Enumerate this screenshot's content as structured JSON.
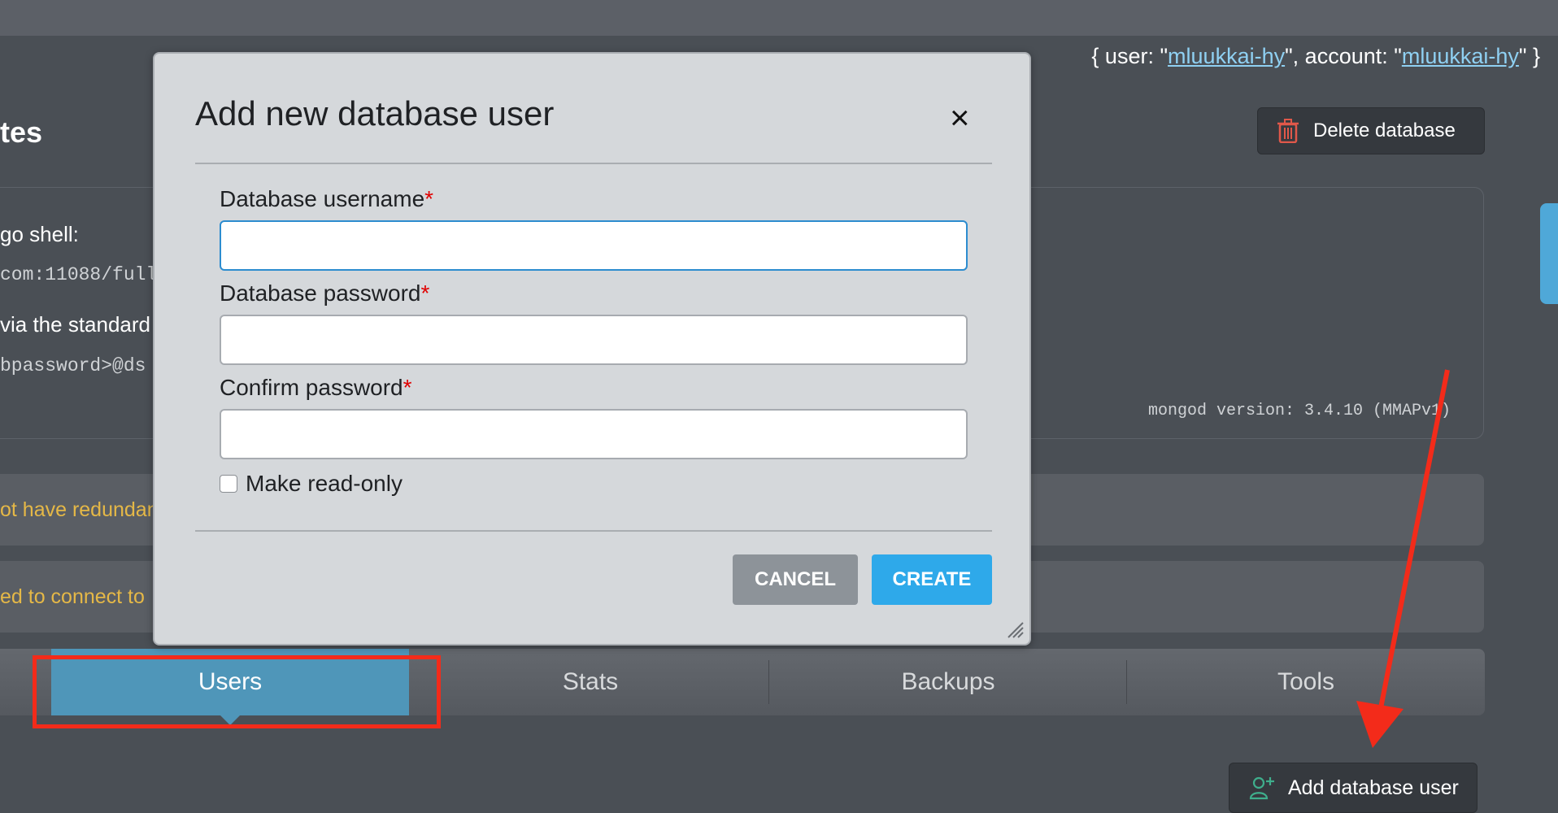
{
  "header": {
    "user_prefix": "{ user: \"",
    "user_name": "mluukkai-hy",
    "account_prefix": "\", account: \"",
    "account_name": "mluukkai-hy",
    "suffix": "\" }"
  },
  "page": {
    "title_partial": "tes",
    "delete_button": "Delete database",
    "shell_label": "go shell:",
    "shell_cmd": "com:11088/full",
    "std_label": "via the standard",
    "std_uri": "bpassword>@ds",
    "version": "mongod version: 3.4.10 (MMAPv1)",
    "alert1": "ot have redundan",
    "alert2": "ed to connect to"
  },
  "tabs": [
    {
      "label": "Users",
      "active": true
    },
    {
      "label": "Stats",
      "active": false
    },
    {
      "label": "Backups",
      "active": false
    },
    {
      "label": "Tools",
      "active": false
    }
  ],
  "add_user_button": "Add database user",
  "modal": {
    "title": "Add new database user",
    "close_icon": "×",
    "fields": [
      {
        "label": "Database username",
        "required_mark": "*",
        "value": ""
      },
      {
        "label": "Database password",
        "required_mark": "*",
        "value": ""
      },
      {
        "label": "Confirm password",
        "required_mark": "*",
        "value": ""
      }
    ],
    "readonly_label": "Make read-only",
    "readonly_checked": false,
    "cancel": "CANCEL",
    "create": "CREATE"
  },
  "colors": {
    "accent": "#2ea9ea",
    "annotation": "#f32b1a",
    "warning_text": "#e5b847"
  },
  "icons": [
    "trash-icon",
    "close-icon",
    "add-user-icon",
    "resize-handle-icon"
  ]
}
